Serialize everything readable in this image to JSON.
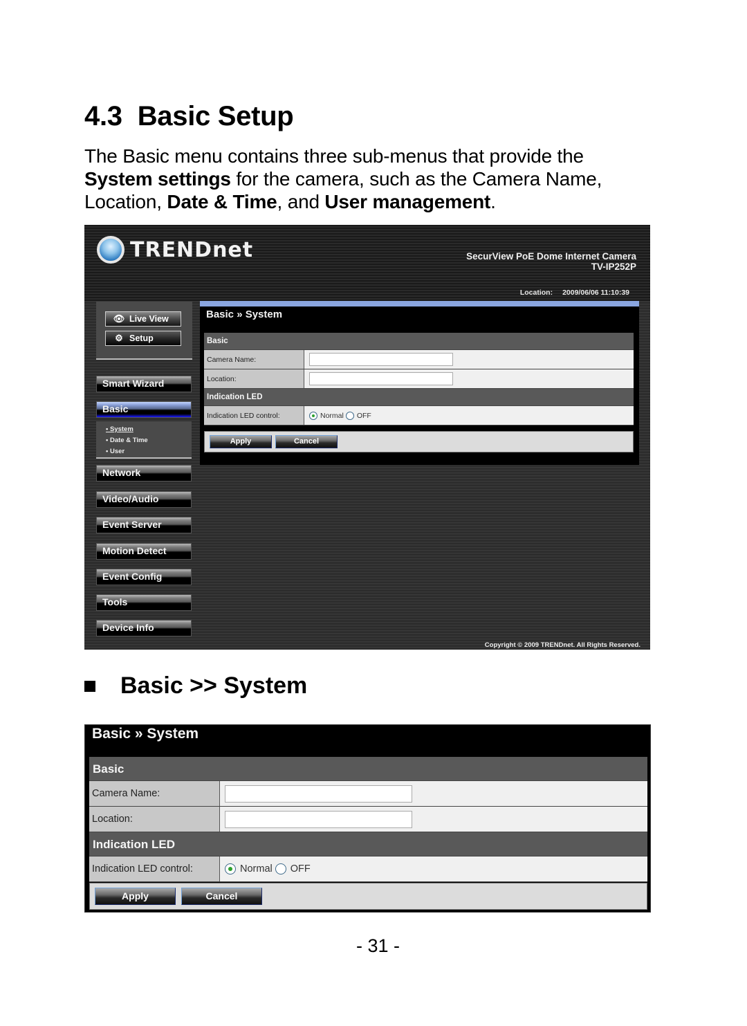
{
  "document": {
    "section_number": "4.3",
    "section_title": "Basic Setup",
    "intro": {
      "t1": "The Basic menu contains three sub-menus that provide the ",
      "b1": "System settings",
      "t2": " for the camera, such as the Camera Name, Location, ",
      "b2": "Date & Time",
      "t3": ", and ",
      "b3": "User management",
      "t4": "."
    },
    "subsection_title": "Basic >> System",
    "page_number": "- 31 -"
  },
  "app": {
    "brand": "TRENDnet",
    "product_name": "SecurView PoE Dome Internet Camera",
    "model": "TV-IP252P",
    "location_label": "Location:",
    "datetime": "2009/06/06 11:10:39",
    "copyright": "Copyright © 2009 TRENDnet. All Rights Reserved.",
    "top_buttons": [
      {
        "label": "Live View",
        "icon": "eye-icon"
      },
      {
        "label": "Setup",
        "icon": "gears-icon"
      }
    ],
    "menu": [
      {
        "label": "Smart Wizard"
      },
      {
        "label": "Basic",
        "active": true
      },
      {
        "label": "Network"
      },
      {
        "label": "Video/Audio"
      },
      {
        "label": "Event Server"
      },
      {
        "label": "Motion Detect"
      },
      {
        "label": "Event Config"
      },
      {
        "label": "Tools"
      },
      {
        "label": "Device Info"
      }
    ],
    "submenu": [
      {
        "label": "• System",
        "current": true
      },
      {
        "label": "• Date & Time"
      },
      {
        "label": "• User"
      }
    ]
  },
  "form": {
    "title": "Basic » System",
    "section_basic": "Basic",
    "camera_name_label": "Camera Name:",
    "camera_name_value": "",
    "location_label": "Location:",
    "location_value": "",
    "section_led": "Indication LED",
    "led_control_label": "Indication LED control:",
    "led_options": [
      "Normal",
      "OFF"
    ],
    "led_selected": "Normal",
    "apply_label": "Apply",
    "cancel_label": "Cancel"
  }
}
